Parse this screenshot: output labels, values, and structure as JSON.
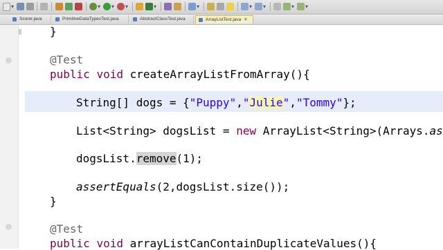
{
  "toolbar": {
    "icons": [
      "new-file-icon",
      "save-icon",
      "print-icon",
      "build-icon",
      "debug-icon",
      "run-icon",
      "external-tools-icon",
      "new-java-project-icon",
      "new-package-icon",
      "new-class-icon",
      "open-type-icon",
      "search-icon",
      "next-annotation-icon",
      "previous-annotation-icon",
      "back-icon",
      "forward-icon"
    ]
  },
  "tabs": [
    {
      "label": "Scorer.java"
    },
    {
      "label": "PrimitiveDataTypesTest.java"
    },
    {
      "label": "AbstractClassTest.java"
    },
    {
      "label": "ArrayListTest.java",
      "close": "✕"
    }
  ],
  "code": {
    "close_brace_top": "}",
    "annotation1": "@Test",
    "method1": {
      "kw1": "public",
      "kw2": "void",
      "name": "createArrayListFromArray(){"
    },
    "line_dogs": {
      "type": "String[] dogs = {",
      "s1": "\"Puppy\"",
      "c1": ",",
      "s2_open": "\"",
      "s2_word": "Julie",
      "s2_close": "\"",
      "c2": ",",
      "s3": "\"Tommy\"",
      "end": "};"
    },
    "line_list": {
      "decl": "List<String> dogsList = ",
      "kw": "new",
      "rest": " ArrayList<String>(Arrays.",
      "ital": "asLi"
    },
    "line_remove": {
      "pre": "dogsList.",
      "method": "remove",
      "post": "(1);"
    },
    "line_assert": {
      "ital": "assertEquals",
      "rest": "(2,dogsList.size());"
    },
    "close_brace_method": "}",
    "annotation2": "@Test",
    "method2": {
      "kw1": "public",
      "kw2": "void",
      "name": "arrayListCanContainDuplicateValues(){"
    }
  }
}
